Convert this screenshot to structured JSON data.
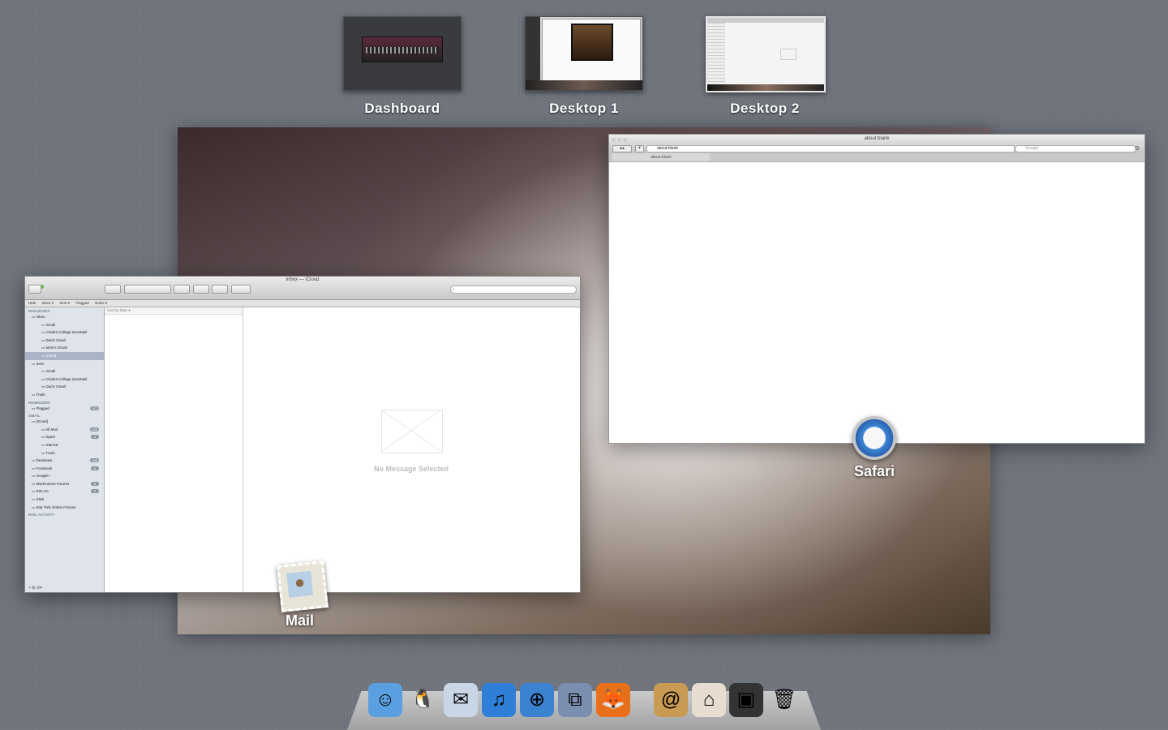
{
  "spaces": [
    {
      "label": "Dashboard"
    },
    {
      "label": "Desktop 1"
    },
    {
      "label": "Desktop 2"
    }
  ],
  "mail_window": {
    "title": "Inbox — iCloud",
    "favorites_bar": [
      "Hide",
      "Inbox ▾",
      "Sent ▾",
      "Flagged",
      "Notes ▾"
    ],
    "sort_label": "Sort by Date ▾",
    "empty_text": "No Message Selected",
    "sidebar": [
      {
        "label": "MAILBOXES",
        "header": true
      },
      {
        "label": "Inbox",
        "indent": 1
      },
      {
        "label": "Gmail",
        "indent": 2
      },
      {
        "label": "Chabot College ZoneMail",
        "indent": 2
      },
      {
        "label": "Dad's Gmail",
        "indent": 2
      },
      {
        "label": "Mom's Gmail",
        "indent": 2
      },
      {
        "label": "iCloud",
        "indent": 2,
        "selected": true
      },
      {
        "label": "Sent",
        "indent": 1
      },
      {
        "label": "Gmail",
        "indent": 2
      },
      {
        "label": "Chabot College ZoneMail",
        "indent": 2
      },
      {
        "label": "Dad's Gmail",
        "indent": 2
      },
      {
        "label": "Trash",
        "indent": 1
      },
      {
        "label": "REMINDERS",
        "header": true
      },
      {
        "label": "Flagged",
        "indent": 1,
        "badge": "377"
      },
      {
        "label": "GMAIL",
        "header": true
      },
      {
        "label": "[Gmail]",
        "indent": 1
      },
      {
        "label": "All Mail",
        "indent": 2,
        "badge": "145"
      },
      {
        "label": "Spam",
        "indent": 2,
        "badge": "3"
      },
      {
        "label": "Starred",
        "indent": 2
      },
      {
        "label": "Trash",
        "indent": 2
      },
      {
        "label": "Dealnews",
        "indent": 1,
        "badge": "190"
      },
      {
        "label": "Facebook",
        "indent": 1,
        "badge": "6"
      },
      {
        "label": "Google+",
        "indent": 1
      },
      {
        "label": "MacRumors Forums",
        "indent": 1,
        "badge": "8"
      },
      {
        "label": "ROLCC",
        "indent": 1,
        "badge": "5"
      },
      {
        "label": "SMS",
        "indent": 1
      },
      {
        "label": "Star Trek Online Forums",
        "indent": 1
      },
      {
        "label": "MAIL ACTIVITY",
        "header": true
      }
    ],
    "footer_icons": "+   ⊞   ⚙▾"
  },
  "safari_window": {
    "title": "about:blank",
    "url": "about:blank",
    "search_placeholder": "Google",
    "tab_label": "about:blank"
  },
  "app_labels": {
    "mail": "Mail",
    "safari": "Safari"
  },
  "dock": [
    {
      "name": "finder-icon",
      "glyph": "☺",
      "color": "#5aa0e0"
    },
    {
      "name": "adium-icon",
      "glyph": "🐧",
      "color": "transparent"
    },
    {
      "name": "mail-icon",
      "glyph": "✉",
      "color": "#c8d6e6"
    },
    {
      "name": "itunes-icon",
      "glyph": "♫",
      "color": "#2f7fd8"
    },
    {
      "name": "safari-icon",
      "glyph": "⊕",
      "color": "#3b82d0"
    },
    {
      "name": "vmware-icon",
      "glyph": "⧉",
      "color": "#7a8fb0"
    },
    {
      "name": "firefox-icon",
      "glyph": "🦊",
      "color": "#e8701a"
    },
    {
      "name": "address-book-icon",
      "glyph": "@",
      "color": "#c89a52"
    },
    {
      "name": "home-folder-icon",
      "glyph": "⌂",
      "color": "#e6ddd0"
    },
    {
      "name": "photo-stack-icon",
      "glyph": "▣",
      "color": "#333"
    },
    {
      "name": "trash-icon",
      "glyph": "🗑",
      "color": "transparent"
    }
  ]
}
